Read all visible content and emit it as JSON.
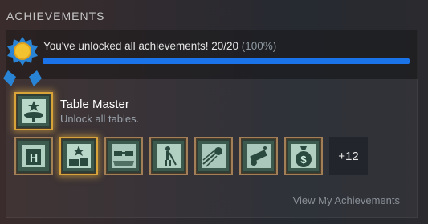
{
  "section": {
    "title": "ACHIEVEMENTS"
  },
  "progress": {
    "text": "You've unlocked all achievements! 20/20",
    "percent_text": "(100%)",
    "fraction": 1.0,
    "bar_color": "#1a73e8"
  },
  "featured": {
    "title": "Table Master",
    "description": "Unlock all tables.",
    "icon": "table-star-icon"
  },
  "achievement_icons": [
    {
      "icon": "hotel-sign-icon"
    },
    {
      "icon": "table-star-icon"
    },
    {
      "icon": "sunglasses-icon"
    },
    {
      "icon": "golfer-icon"
    },
    {
      "icon": "flying-ball-icon"
    },
    {
      "icon": "cannon-icon"
    },
    {
      "icon": "money-bag-icon"
    }
  ],
  "more": {
    "label": "+12"
  },
  "footer": {
    "link_label": "View My Achievements"
  }
}
